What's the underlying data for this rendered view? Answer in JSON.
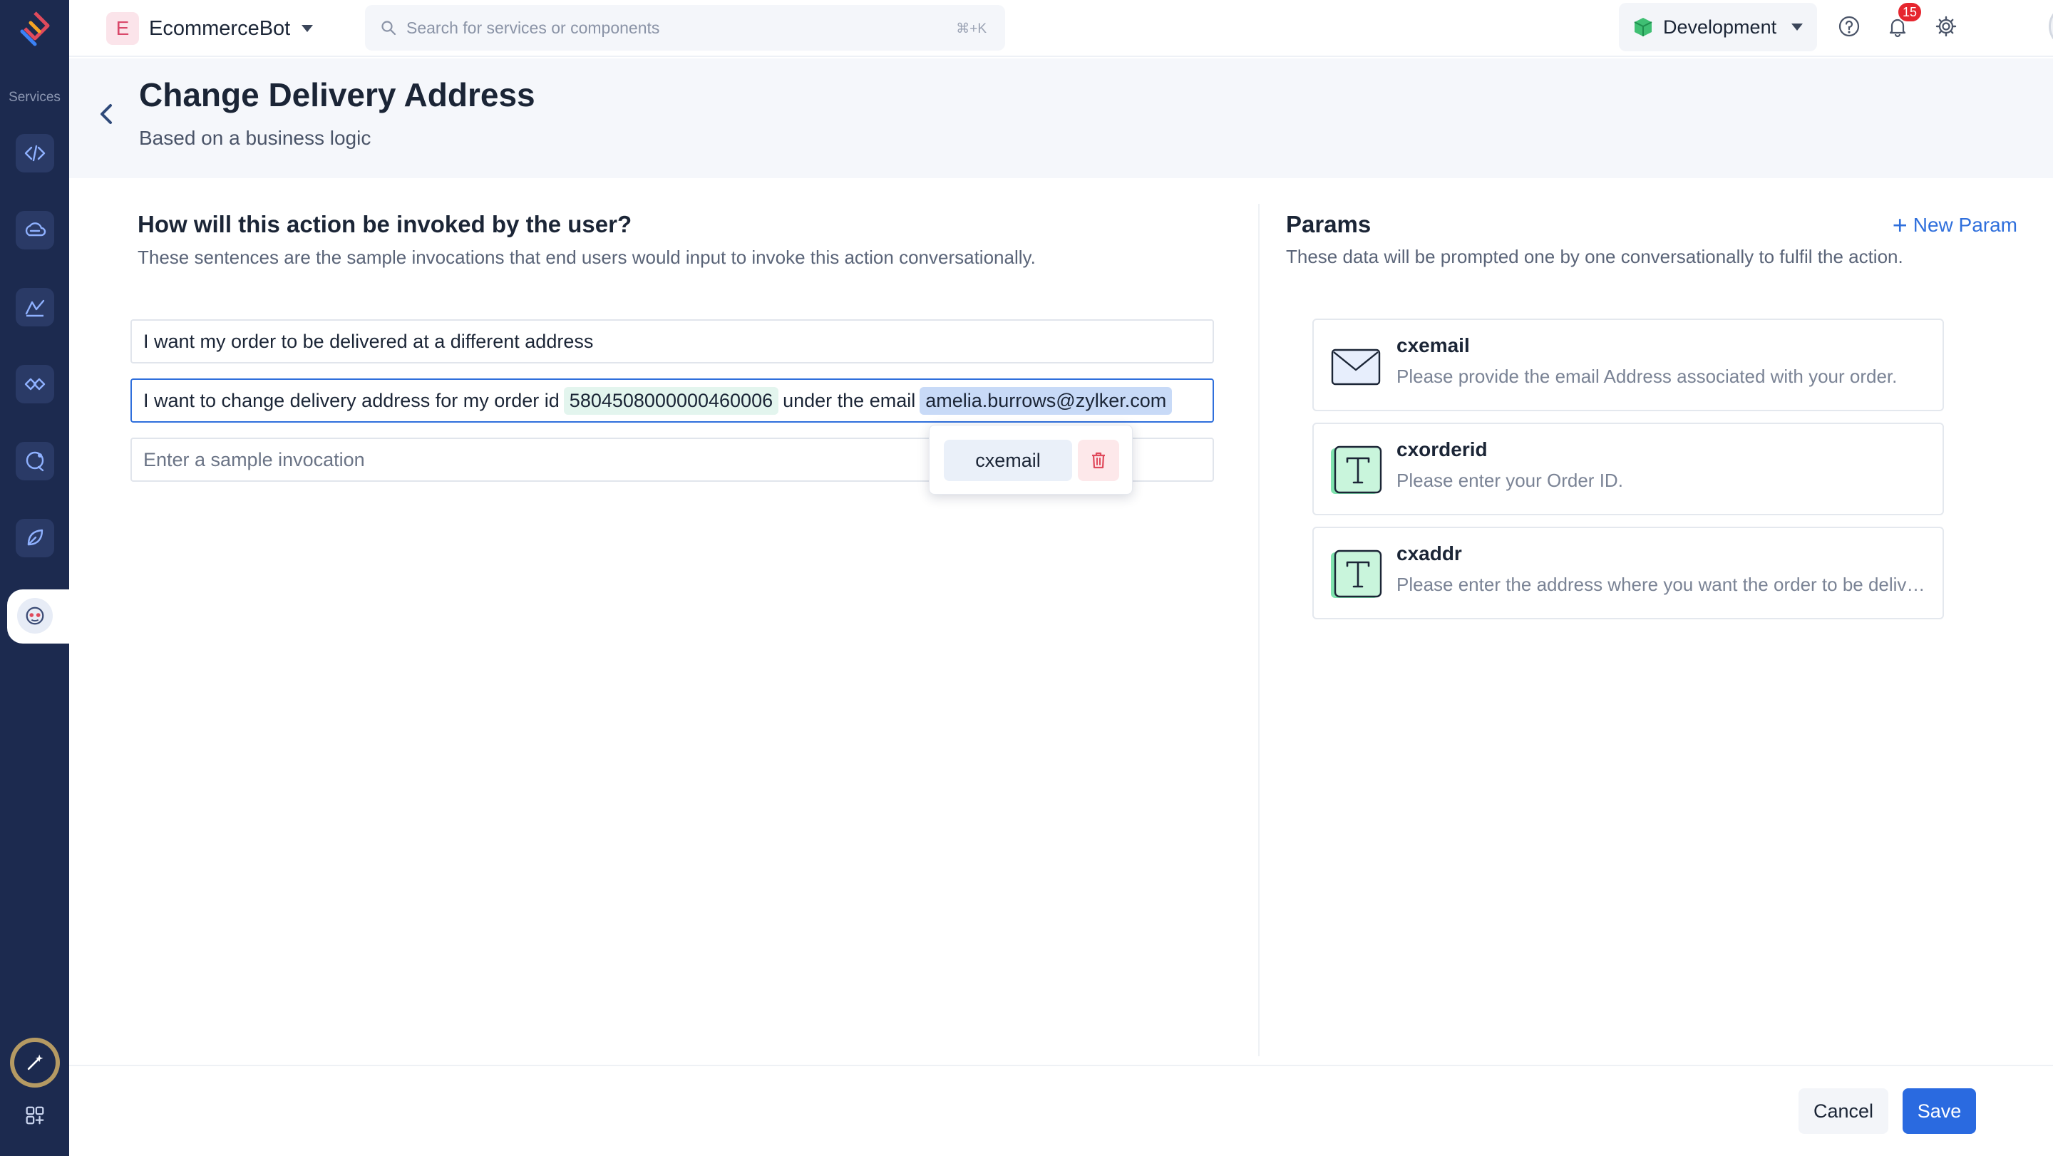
{
  "sidebar": {
    "services_label": "Services"
  },
  "topbar": {
    "bot_initial": "E",
    "bot_name": "EcommerceBot",
    "search_placeholder": "Search for services or components",
    "search_shortcut": "⌘+K",
    "environment": "Development",
    "notification_count": "15"
  },
  "header": {
    "title": "Change Delivery Address",
    "subtitle": "Based on a business logic"
  },
  "invocations": {
    "title": "How will this action be invoked by the user?",
    "description": "These sentences are the sample invocations that end users would input to invoke this action conversationally.",
    "items": [
      {
        "text": "I want my order to be delivered at a different address"
      },
      {
        "prefix": "I want to change delivery address for my order id",
        "order_id": "5804508000000460006",
        "middle": "under the email",
        "email": "amelia.burrows@zylker.com"
      }
    ],
    "new_placeholder": "Enter a sample invocation",
    "popover_param": "cxemail"
  },
  "params": {
    "title": "Params",
    "description": "These data will be prompted one by one conversationally to fulfil the action.",
    "new_param_label": "New Param",
    "items": [
      {
        "name": "cxemail",
        "prompt": "Please provide the email Address associated with your order.",
        "icon": "envelope-icon"
      },
      {
        "name": "cxorderid",
        "prompt": "Please enter your Order ID.",
        "icon": "text-type-icon"
      },
      {
        "name": "cxaddr",
        "prompt": "Please enter the address where you want the order to be delivered.",
        "icon": "text-type-icon"
      }
    ]
  },
  "footer": {
    "cancel_label": "Cancel",
    "save_label": "Save"
  },
  "colors": {
    "rail": "#1c2a4f",
    "accent": "#2a6ae0",
    "danger": "#e6262f"
  }
}
